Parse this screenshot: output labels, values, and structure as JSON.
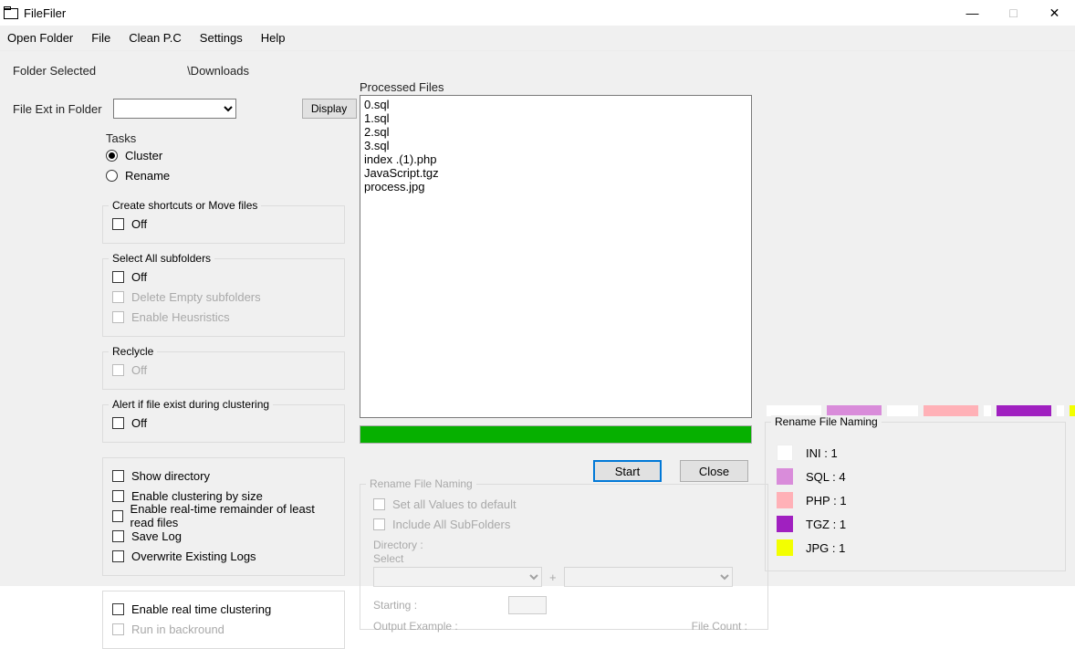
{
  "window": {
    "title": "FileFiler"
  },
  "menu": {
    "open_folder": "Open Folder",
    "file": "File",
    "clean_pc": "Clean P.C",
    "settings": "Settings",
    "help": "Help"
  },
  "folder_selected_label": "Folder Selected",
  "folder_selected_value": "\\Downloads",
  "file_ext_label": "File Ext in Folder",
  "display_btn": "Display",
  "tasks": {
    "title": "Tasks",
    "cluster": "Cluster",
    "rename": "Rename"
  },
  "shortcuts": {
    "title": "Create shortcuts or Move files",
    "off": "Off"
  },
  "subfolders": {
    "title": "Select All subfolders",
    "off": "Off",
    "delete_empty": "Delete Empty subfolders",
    "heuristics": "Enable Heusristics"
  },
  "recycle": {
    "title": "Reclycle",
    "off": "Off"
  },
  "alert": {
    "title": "Alert if file exist during clustering",
    "off": "Off"
  },
  "options": {
    "show_dir": "Show directory",
    "cluster_size": "Enable clustering by size",
    "realtime_remainder": "Enable real-time remainder of least read files",
    "save_log": "Save Log",
    "overwrite_logs": "Overwrite Existing Logs"
  },
  "realtime": {
    "enable": "Enable real time clustering",
    "background": "Run in backround"
  },
  "processed": {
    "label": "Processed Files",
    "files": [
      "0.sql",
      "1.sql",
      "2.sql",
      "3.sql",
      "index .(1).php",
      "JavaScript.tgz",
      "process.jpg"
    ]
  },
  "start_btn": "Start",
  "close_btn": "Close",
  "rename_section": {
    "title": "Rename File Naming",
    "set_defaults": "Set all Values to default",
    "include_subfolders": "Include All SubFolders",
    "directory_lbl": "Directory  :",
    "select_lbl": "Select",
    "plus": "+",
    "starting_lbl": "Starting     :",
    "output_lbl": "Output Example    :",
    "filecount_lbl": "File Count   :"
  },
  "swatches": [
    {
      "color": "#ffffff",
      "width": 60
    },
    {
      "color": "#d98cda",
      "width": 60
    },
    {
      "color": "#ffffff",
      "width": 34
    },
    {
      "color": "#ffb1b7",
      "width": 60
    },
    {
      "color": "#ffffff",
      "width": 8
    },
    {
      "color": "#a020c0",
      "width": 60
    },
    {
      "color": "#ffffff",
      "width": 8
    },
    {
      "color": "#f3ff00",
      "width": 60
    }
  ],
  "legend": {
    "title": "Rename File Naming",
    "items": [
      {
        "color": "#ffffff",
        "label": "INI : 1"
      },
      {
        "color": "#d98cda",
        "label": "SQL : 4"
      },
      {
        "color": "#ffb1b7",
        "label": "PHP : 1"
      },
      {
        "color": "#a020c0",
        "label": "TGZ : 1"
      },
      {
        "color": "#f3ff00",
        "label": "JPG : 1"
      }
    ]
  }
}
